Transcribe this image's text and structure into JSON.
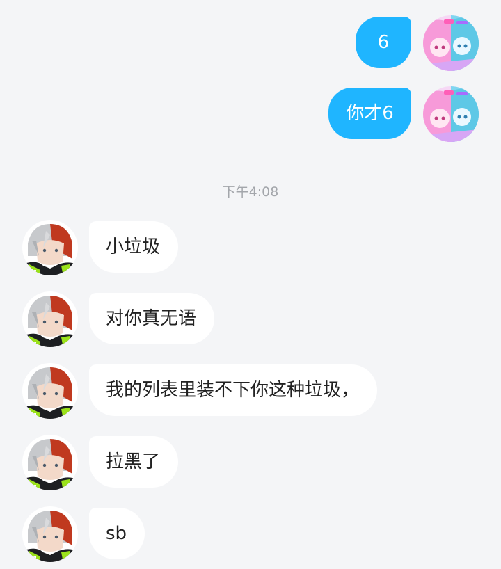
{
  "colors": {
    "background": "#f4f5f7",
    "sent_bubble": "#1fb5ff",
    "received_bubble": "#ffffff",
    "timestamp_text": "#a3a6ab"
  },
  "sent_messages": [
    {
      "text": "6",
      "avatar": "anime-duo-pink-blue-avatar"
    },
    {
      "text": "你才6",
      "avatar": "anime-duo-pink-blue-avatar"
    }
  ],
  "timestamp": "下午4:08",
  "received_messages": [
    {
      "text": "小垃圾",
      "avatar": "white-red-hair-anime-avatar"
    },
    {
      "text": "对你真无语",
      "avatar": "white-red-hair-anime-avatar"
    },
    {
      "text": "我的列表里装不下你这种垃圾，",
      "avatar": "white-red-hair-anime-avatar"
    },
    {
      "text": "拉黑了",
      "avatar": "white-red-hair-anime-avatar"
    },
    {
      "text": "sb",
      "avatar": "white-red-hair-anime-avatar"
    }
  ]
}
